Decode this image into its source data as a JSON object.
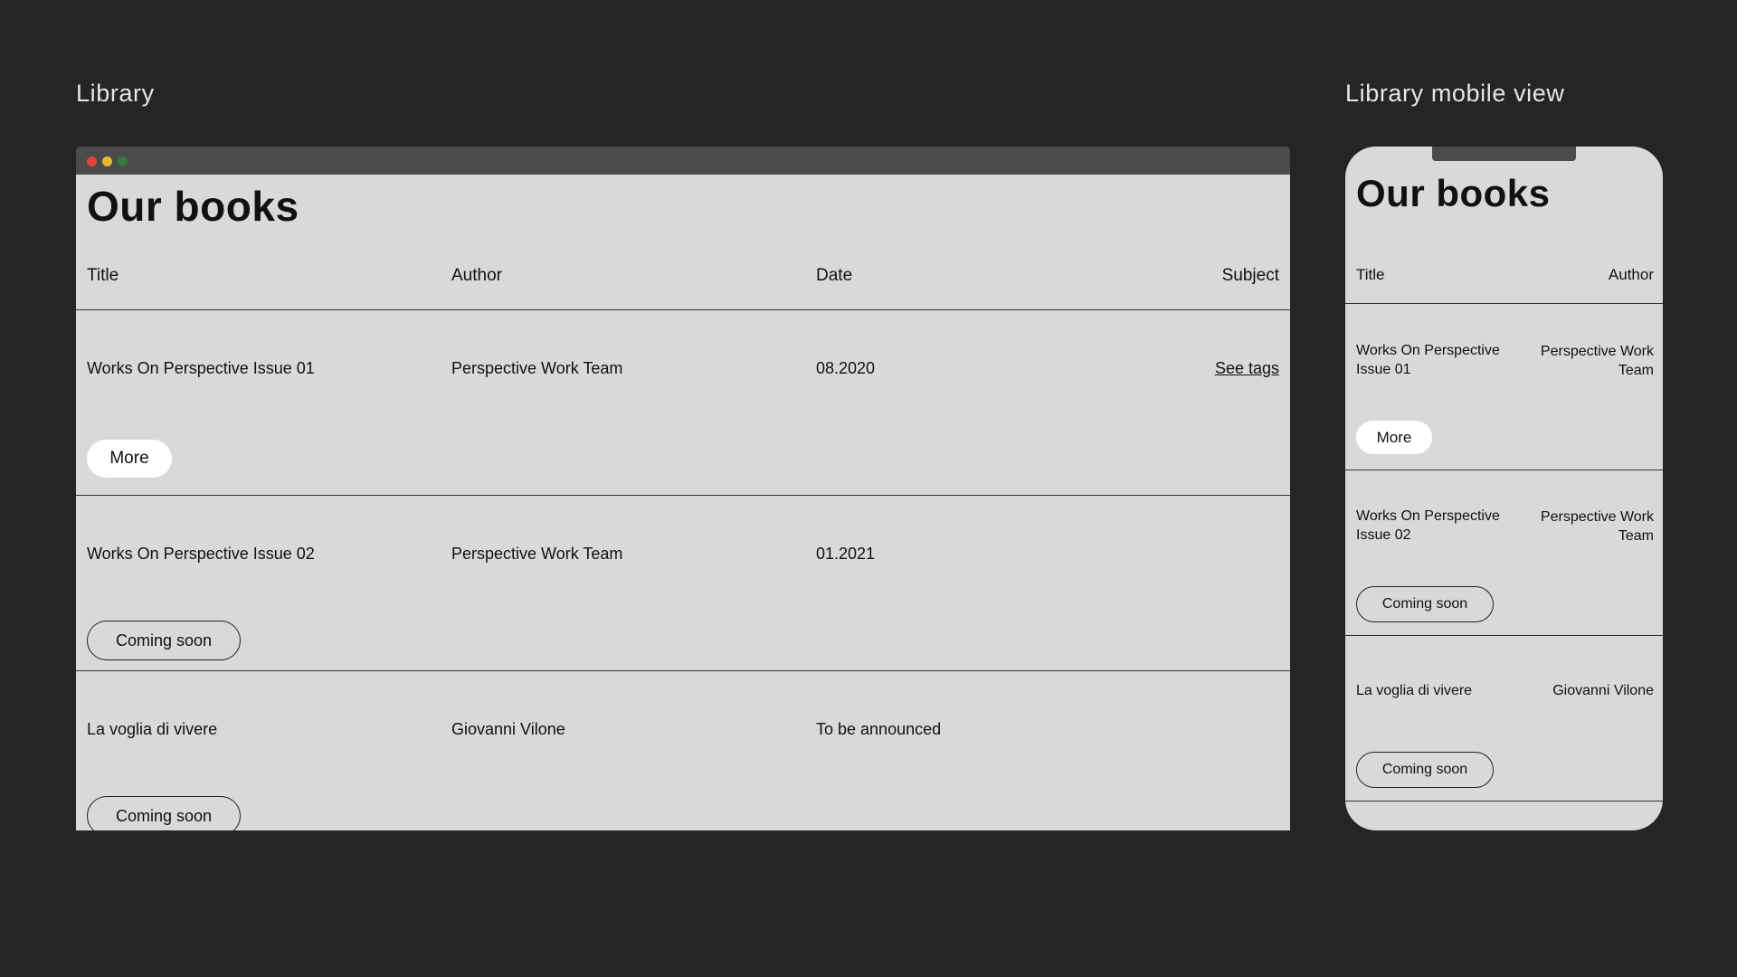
{
  "desktop": {
    "section_label": "Library",
    "page_title": "Our books",
    "columns": {
      "title": "Title",
      "author": "Author",
      "date": "Date",
      "subject": "Subject"
    },
    "rows": [
      {
        "title": "Works On Perspective Issue 01",
        "author": "Perspective Work Team",
        "date": "08.2020",
        "subject_link": "See tags",
        "button": "More"
      },
      {
        "title": "Works On Perspective Issue 02",
        "author": "Perspective Work Team",
        "date": "01.2021",
        "button": "Coming soon"
      },
      {
        "title": "La voglia di vivere",
        "author": "Giovanni Vilone",
        "date": "To be announced",
        "button": "Coming soon"
      }
    ],
    "window_dots": [
      "#e0443a",
      "#e8b630",
      "#3a7a3c"
    ]
  },
  "mobile": {
    "section_label": "Library mobile view",
    "page_title": "Our books",
    "columns": {
      "title": "Title",
      "author": "Author"
    },
    "rows": [
      {
        "title": "Works On Perspective Issue 01",
        "author": "Perspective Work Team",
        "button": "More"
      },
      {
        "title": "Works On Perspective Issue 02",
        "author": "Perspective Work Team",
        "button": "Coming soon"
      },
      {
        "title": "La voglia di vivere",
        "author": "Giovanni Vilone",
        "button": "Coming soon"
      }
    ]
  },
  "colors": {
    "background": "#252525",
    "panel": "#d9d9d9",
    "titlebar": "#4b4b4b",
    "label_text": "#e6e6e6"
  }
}
